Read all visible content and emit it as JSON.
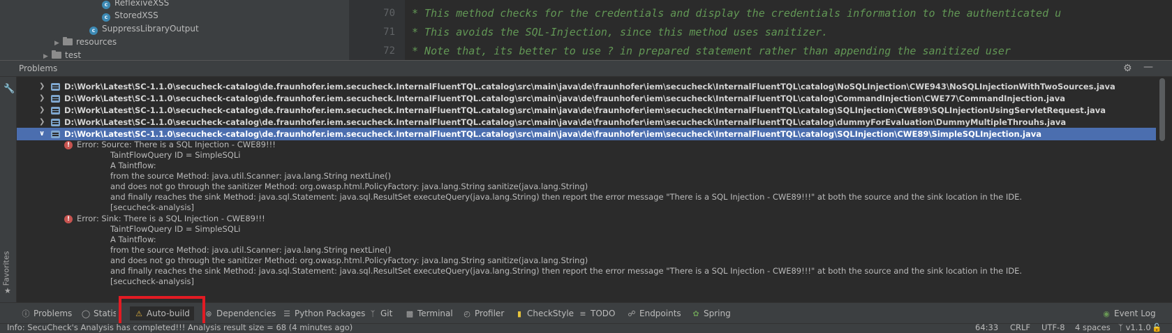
{
  "project_tree": {
    "items": [
      {
        "label": "ReflexiveXSS",
        "kind": "class"
      },
      {
        "label": "StoredXSS",
        "kind": "class"
      },
      {
        "label": "SuppressLibraryOutput",
        "kind": "class"
      },
      {
        "label": "resources",
        "kind": "folder"
      },
      {
        "label": "test",
        "kind": "folder"
      }
    ]
  },
  "editor": {
    "lines": [
      {
        "number": "70",
        "text": "* This method checks for the credentials and display the credentials information to the authenticated u"
      },
      {
        "number": "71",
        "text": "* This avoids the SQL-Injection, since this method uses sanitizer."
      },
      {
        "number": "72",
        "text": "* Note that, its better to use ? in prepared statement rather than appending the sanitized user"
      }
    ]
  },
  "problems": {
    "title": "Problems",
    "files": [
      {
        "path": "D:\\Work\\Latest\\SC-1.1.0\\secucheck-catalog\\de.fraunhofer.iem.secucheck.InternalFluentTQL.catalog\\src\\main\\java\\de\\fraunhofer\\iem\\secucheck\\InternalFluentTQL\\catalog\\NoSQLInjection\\CWE943\\NoSQLInjectionWithTwoSources.java",
        "expanded": false
      },
      {
        "path": "D:\\Work\\Latest\\SC-1.1.0\\secucheck-catalog\\de.fraunhofer.iem.secucheck.InternalFluentTQL.catalog\\src\\main\\java\\de\\fraunhofer\\iem\\secucheck\\InternalFluentTQL\\catalog\\CommandInjection\\CWE77\\CommandInjection.java",
        "expanded": false
      },
      {
        "path": "D:\\Work\\Latest\\SC-1.1.0\\secucheck-catalog\\de.fraunhofer.iem.secucheck.InternalFluentTQL.catalog\\src\\main\\java\\de\\fraunhofer\\iem\\secucheck\\InternalFluentTQL\\catalog\\SQLInjection\\CWE89\\SQLInjectionUsingServletRequest.java",
        "expanded": false
      },
      {
        "path": "D:\\Work\\Latest\\SC-1.1.0\\secucheck-catalog\\de.fraunhofer.iem.secucheck.InternalFluentTQL.catalog\\src\\main\\java\\de\\fraunhofer\\iem\\secucheck\\InternalFluentTQL\\catalog\\dummyForEvaluation\\DummyMultipleThrouhs.java",
        "expanded": false
      },
      {
        "path": "D:\\Work\\Latest\\SC-1.1.0\\secucheck-catalog\\de.fraunhofer.iem.secucheck.InternalFluentTQL.catalog\\src\\main\\java\\de\\fraunhofer\\iem\\secucheck\\InternalFluentTQL\\catalog\\SQLInjection\\CWE89\\SimpleSQLInjection.java",
        "expanded": true
      }
    ],
    "errors": [
      {
        "heading": "Error: Source: There is a SQL Injection - CWE89!!!",
        "lines": [
          "TaintFlowQuery ID = SimpleSQLi",
          "A Taintflow:",
          "from the source Method: java.util.Scanner: java.lang.String nextLine()",
          "and does not go through the sanitizer Method: org.owasp.html.PolicyFactory: java.lang.String sanitize(java.lang.String)",
          "and finally reaches the sink Method: java.sql.Statement: java.sql.ResultSet executeQuery(java.lang.String) then report the error message \"There is a SQL Injection - CWE89!!!\" at both the source and the sink location in the IDE.",
          " [secucheck-analysis]"
        ]
      },
      {
        "heading": "Error: Sink: There is a SQL Injection - CWE89!!!",
        "lines": [
          "TaintFlowQuery ID = SimpleSQLi",
          "A Taintflow:",
          "from the source Method: java.util.Scanner: java.lang.String nextLine()",
          "and does not go through the sanitizer Method: org.owasp.html.PolicyFactory: java.lang.String sanitize(java.lang.String)",
          "and finally reaches the sink Method: java.sql.Statement: java.sql.ResultSet executeQuery(java.lang.String) then report the error message \"There is a SQL Injection - CWE89!!!\" at both the source and the sink location in the IDE.",
          " [secucheck-analysis]"
        ]
      }
    ]
  },
  "left_strip": {
    "favorites": "Favorites"
  },
  "tool_windows": [
    {
      "label": "Problems",
      "icon": "info-icon"
    },
    {
      "label": "Statistic",
      "icon": "statistic-icon"
    },
    {
      "label": "Auto-build",
      "icon": "warning-icon",
      "active": true
    },
    {
      "label": "Dependencies",
      "icon": "dependencies-icon"
    },
    {
      "label": "Python Packages",
      "icon": "layers-icon"
    },
    {
      "label": "Git",
      "icon": "git-icon"
    },
    {
      "label": "Terminal",
      "icon": "terminal-icon"
    },
    {
      "label": "Profiler",
      "icon": "profiler-icon"
    },
    {
      "label": "CheckStyle",
      "icon": "checkstyle-icon"
    },
    {
      "label": "TODO",
      "icon": "list-icon"
    },
    {
      "label": "Endpoints",
      "icon": "endpoints-icon"
    },
    {
      "label": "Spring",
      "icon": "spring-icon"
    },
    {
      "label": "Event Log",
      "icon": "event-log-icon"
    }
  ],
  "status_bar": {
    "message": "Info: SecuCheck's Analysis has completed!!! Analysis result size = 68 (4 minutes ago)",
    "position": "64:33",
    "line_separator": "CRLF",
    "encoding": "UTF-8",
    "indent": "4 spaces",
    "vcs": "v1.1.0"
  },
  "colors": {
    "accent_selection": "#4b6eaf",
    "error": "#c75450",
    "highlight_box": "#e21b23",
    "comment": "#629755"
  }
}
